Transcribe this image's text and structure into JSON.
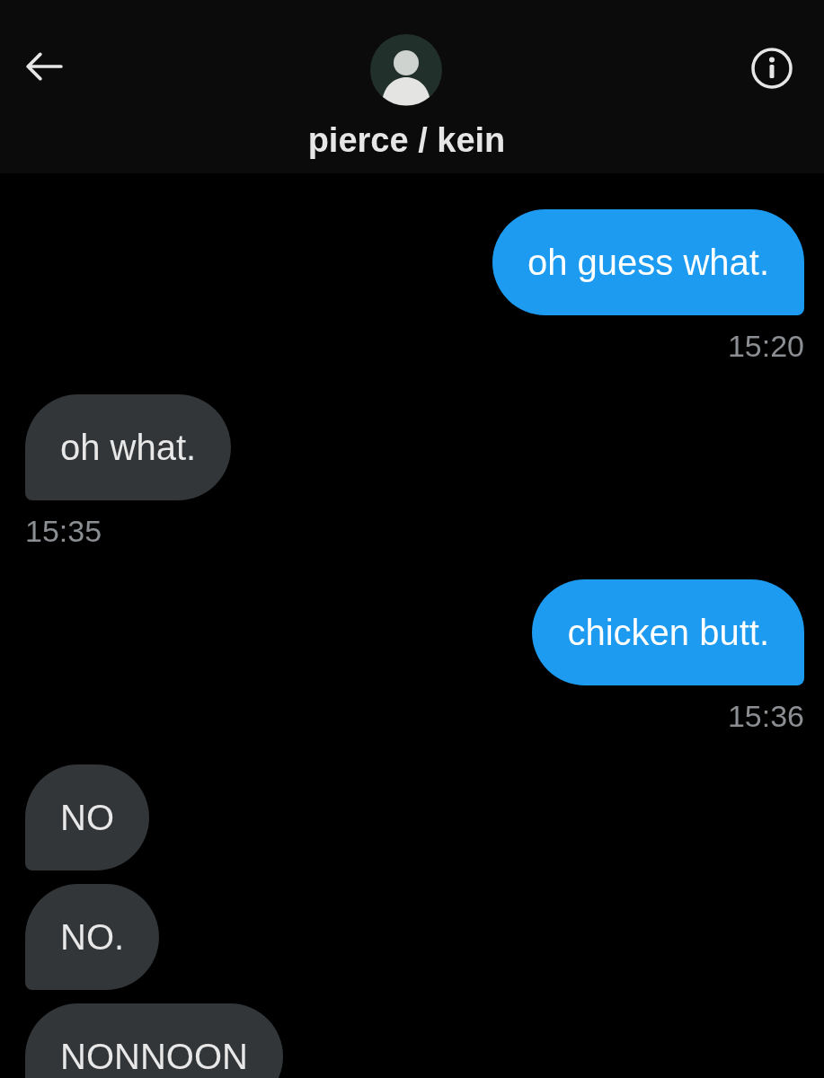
{
  "header": {
    "title": "pierce / kein"
  },
  "messages": [
    {
      "kind": "sent",
      "text": "oh guess what.",
      "time": "15:20"
    },
    {
      "kind": "received",
      "text": "oh what.",
      "time": "15:35"
    },
    {
      "kind": "sent",
      "text": "chicken butt.",
      "time": "15:36"
    },
    {
      "kind": "received",
      "text": "NO"
    },
    {
      "kind": "received",
      "text": "NO."
    },
    {
      "kind": "received",
      "text": "NONNOON"
    }
  ]
}
